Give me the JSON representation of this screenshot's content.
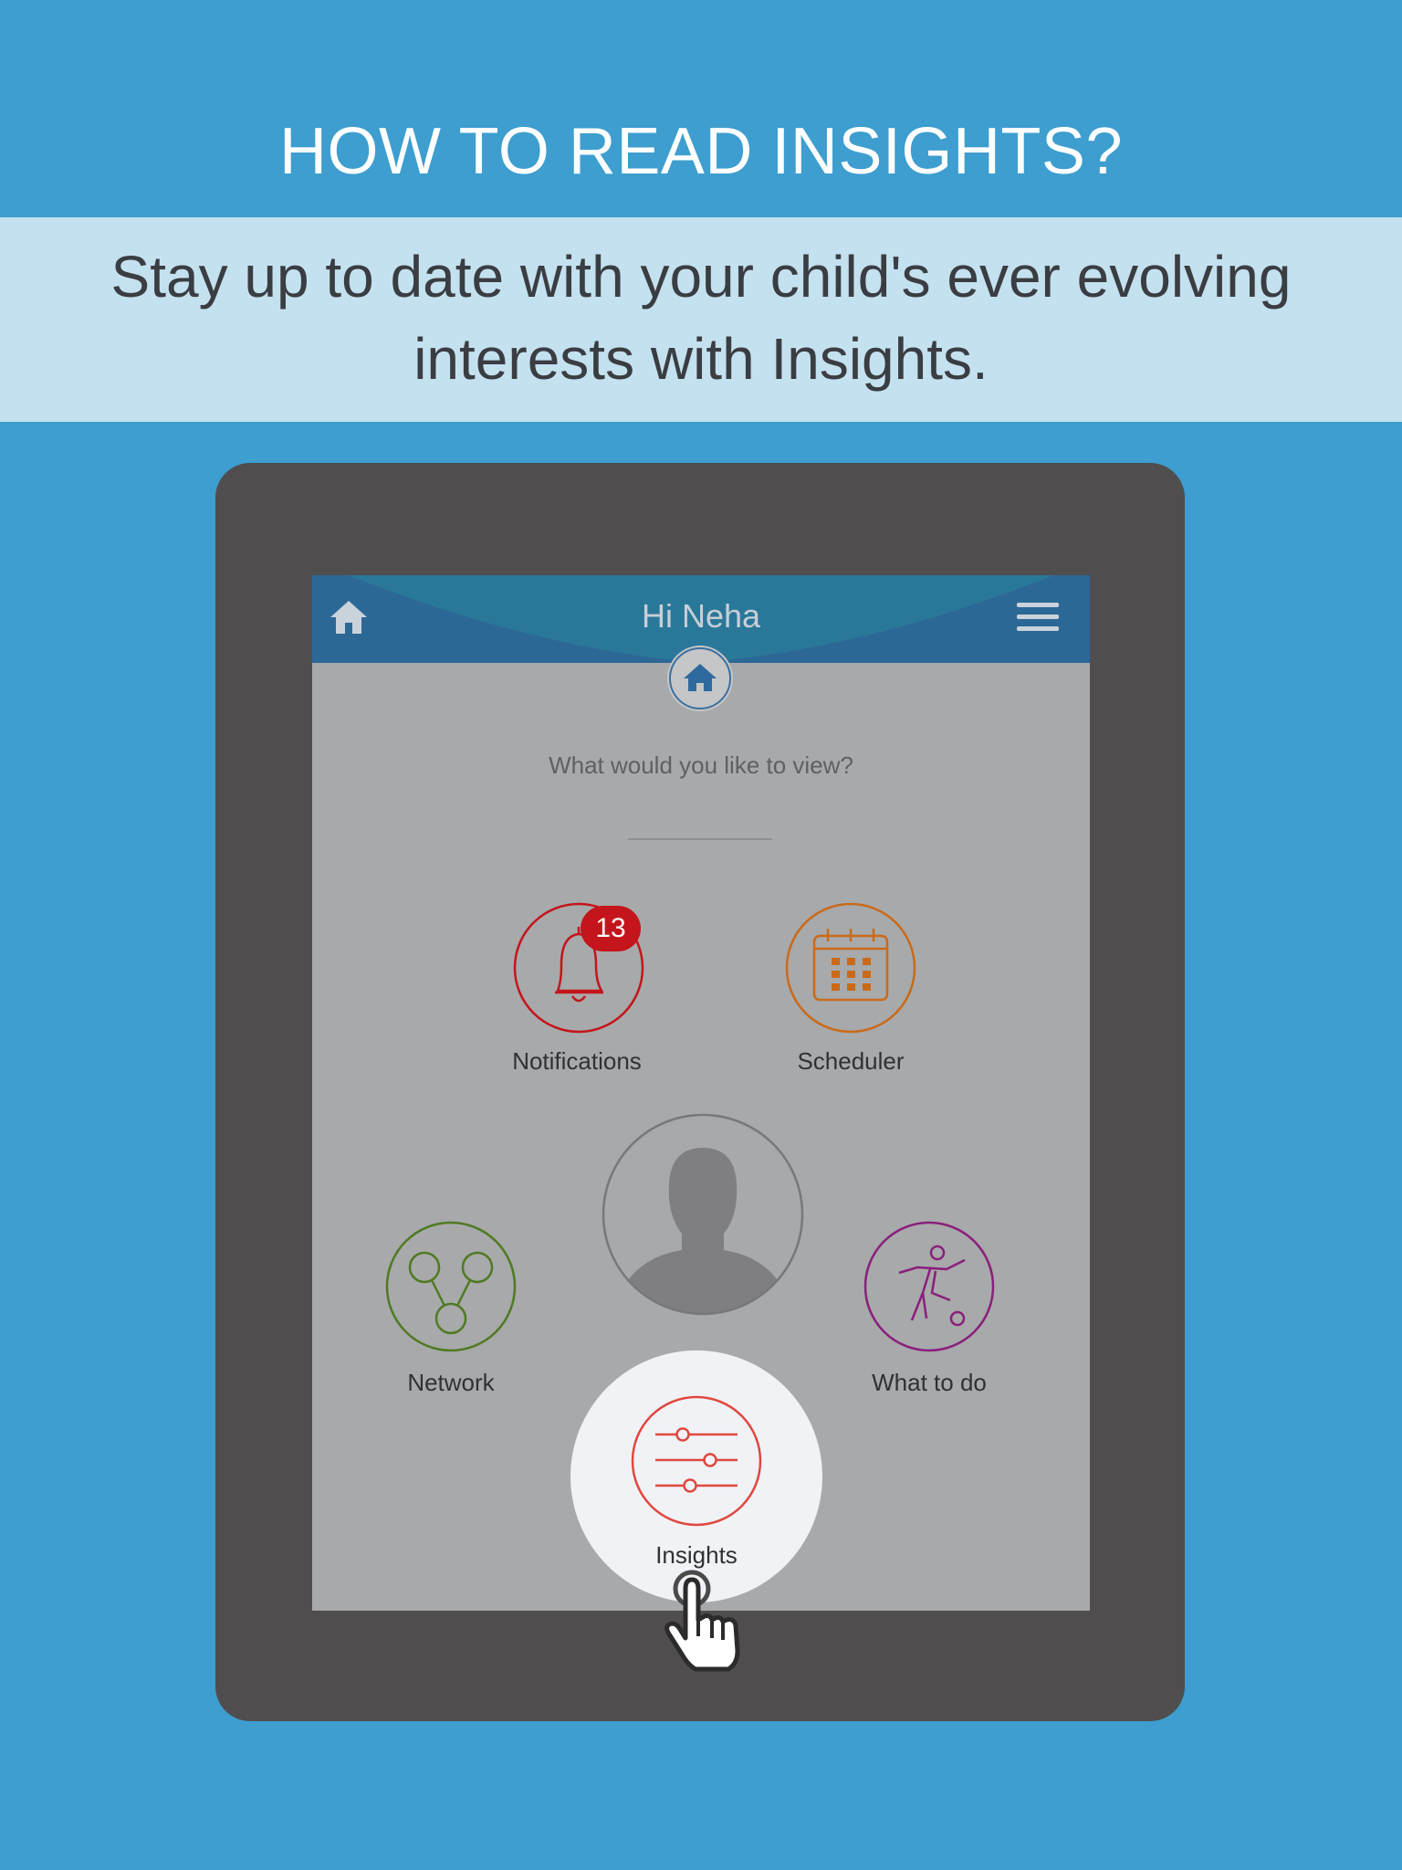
{
  "promo": {
    "title": "HOW TO READ INSIGHTS?",
    "subtitle": "Stay up to date with your child's ever evolving interests with Insights."
  },
  "app": {
    "header": {
      "greeting": "Hi Neha",
      "home_icon": "home-icon",
      "menu_icon": "hamburger-menu-icon"
    },
    "prompt": "What would you like to view?",
    "features": {
      "notifications": {
        "label": "Notifications",
        "count": "13",
        "icon": "bell-icon",
        "color": "#c3151b"
      },
      "scheduler": {
        "label": "Scheduler",
        "icon": "calendar-icon",
        "color": "#c96a1a"
      },
      "network": {
        "label": "Network",
        "icon": "network-icon",
        "color": "#4f7a22"
      },
      "what_to_do": {
        "label": "What to do",
        "icon": "soccer-player-icon",
        "color": "#8a1f7c"
      },
      "insights": {
        "label": "Insights",
        "icon": "sliders-icon",
        "color": "#e0483f"
      }
    },
    "avatar_icon": "profile-silhouette-icon"
  },
  "colors": {
    "background": "#3d9ecf",
    "subtitle_band": "#c4e1ef",
    "tablet_frame": "#4f4d4e",
    "screen": "#a8a9aa",
    "header_dark": "#2c6a91",
    "header_light": "#2a7fa2"
  },
  "cursor_icon": "hand-pointer-icon"
}
